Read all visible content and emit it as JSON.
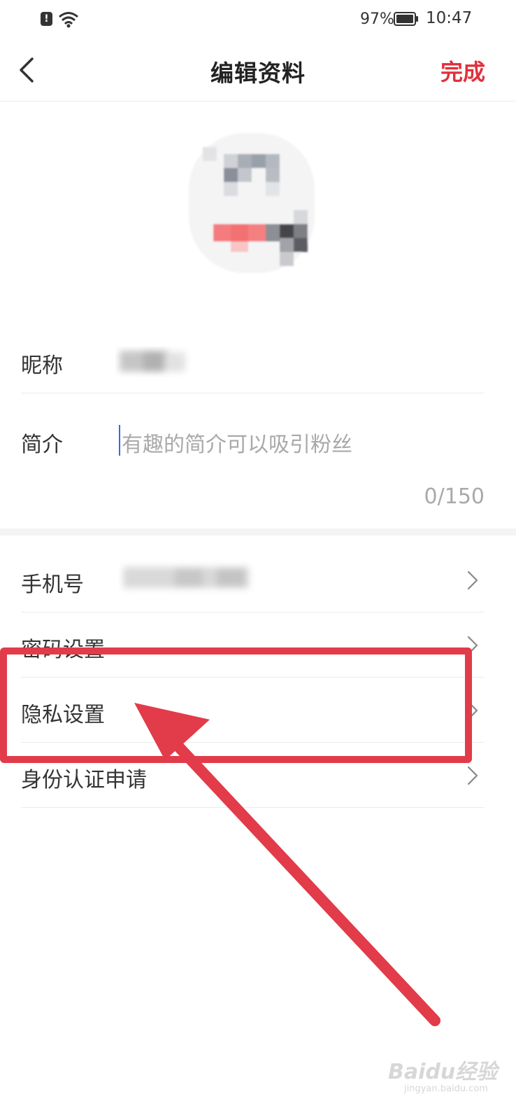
{
  "status_bar": {
    "alert_glyph": "!",
    "battery_percent": "97%",
    "time": "10:47"
  },
  "header": {
    "title": "编辑资料",
    "done_label": "完成"
  },
  "profile": {
    "nickname_label": "昵称",
    "bio_label": "简介",
    "bio_placeholder": "有趣的简介可以吸引粉丝",
    "bio_counter": "0/150"
  },
  "settings": {
    "items": [
      {
        "label": "手机号"
      },
      {
        "label": "密码设置"
      },
      {
        "label": "隐私设置"
      },
      {
        "label": "身份认证申请"
      }
    ]
  },
  "watermark": {
    "brand": "Baidu经验",
    "url": "jingyan.baidu.com"
  },
  "colors": {
    "accent": "#e0303c",
    "annotation": "#e23b49",
    "cursor": "#2b6ee8"
  }
}
